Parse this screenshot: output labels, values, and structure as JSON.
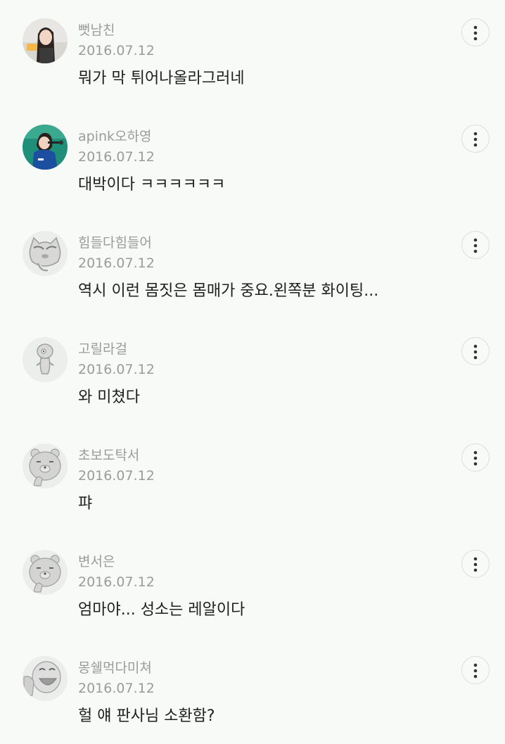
{
  "comments": [
    {
      "nickname": "뻣남친",
      "date": "2016.07.12",
      "text": "뭐가 막 튀어나올라그러네",
      "avatar_icon": "photo-avatar-girl-dark-hair"
    },
    {
      "nickname": "apink오하영",
      "date": "2016.07.12",
      "text": "대박이다 ㅋㅋㅋㅋㅋㅋ",
      "avatar_icon": "photo-avatar-singer-microphone"
    },
    {
      "nickname": "힘들다힘들어",
      "date": "2016.07.12",
      "text": "역시 이런 몸짓은 몸매가 중요.왼쪽분 화이팅...",
      "avatar_icon": "cartoon-cat-avatar"
    },
    {
      "nickname": "고릴라걸",
      "date": "2016.07.12",
      "text": "와 미쳤다",
      "avatar_icon": "cartoon-creature-avatar"
    },
    {
      "nickname": "초보도탁서",
      "date": "2016.07.12",
      "text": "퍄",
      "avatar_icon": "cartoon-bear-avatar"
    },
    {
      "nickname": "변서은",
      "date": "2016.07.12",
      "text": "엄마야... 성소는 레알이다",
      "avatar_icon": "cartoon-bear-avatar"
    },
    {
      "nickname": "몽쉘먹다미쳐",
      "date": "2016.07.12",
      "text": "헐 얘 판사님 소환함?",
      "avatar_icon": "cartoon-laughing-avatar"
    }
  ],
  "more_icon": "more-vertical-icon",
  "colors": {
    "background": "#f8faf7",
    "meta_text": "#9a9c99",
    "body_text": "#1e1e1e",
    "button_border": "#dcdedb"
  }
}
